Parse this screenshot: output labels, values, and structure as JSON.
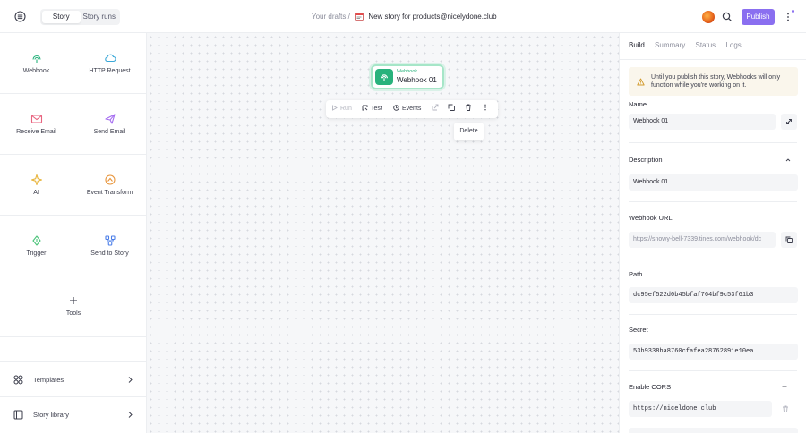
{
  "topbar": {
    "tabs": [
      {
        "label": "Story",
        "active": true
      },
      {
        "label": "Story runs",
        "active": false
      }
    ],
    "breadcrumb_prefix": "Your drafts /",
    "story_title": "New story for products@nicelydone.club",
    "publish_label": "Publish"
  },
  "sidebar": {
    "actions": [
      {
        "label": "Webhook",
        "icon": "webhook-icon",
        "color": "#28b27c"
      },
      {
        "label": "HTTP Request",
        "icon": "cloud-icon",
        "color": "#3aa8d8"
      },
      {
        "label": "Receive Email",
        "icon": "mail-icon",
        "color": "#e8637f"
      },
      {
        "label": "Send Email",
        "icon": "send-icon",
        "color": "#a46bf0"
      },
      {
        "label": "AI",
        "icon": "sparkle-icon",
        "color": "#e8b43a"
      },
      {
        "label": "Event Transform",
        "icon": "transform-icon",
        "color": "#e8943a"
      },
      {
        "label": "Trigger",
        "icon": "trigger-icon",
        "color": "#4cc47a"
      },
      {
        "label": "Send to Story",
        "icon": "story-icon",
        "color": "#4a7de8"
      }
    ],
    "tools_label": "Tools",
    "templates_label": "Templates",
    "library_label": "Story library"
  },
  "canvas": {
    "node": {
      "type": "Webhook",
      "name": "Webhook 01"
    },
    "toolbar": {
      "run": "Run",
      "test": "Test",
      "events": "Events"
    },
    "delete_label": "Delete"
  },
  "panel": {
    "tabs": [
      {
        "label": "Build",
        "active": true
      },
      {
        "label": "Summary",
        "active": false
      },
      {
        "label": "Status",
        "active": false
      },
      {
        "label": "Logs",
        "active": false
      }
    ],
    "alert": "Until you publish this story, Webhooks will only function while you're working on it.",
    "name_label": "Name",
    "name_value": "Webhook 01",
    "description_label": "Description",
    "description_value": "Webhook 01",
    "url_label": "Webhook URL",
    "url_value": "https://snowy-bell-7339.tines.com/webhook/dc",
    "path_label": "Path",
    "path_value": "dc95ef522d0b45bfaf764bf9c53f61b3",
    "secret_label": "Secret",
    "secret_value": "53b9338ba8760cfafea28762891e10ea",
    "cors_label": "Enable CORS",
    "cors_value": "https://niceldone.club"
  },
  "colors": {
    "accent": "#8a6ff0",
    "webhook": "#28b27c",
    "alert_bg": "#faf6ec"
  }
}
